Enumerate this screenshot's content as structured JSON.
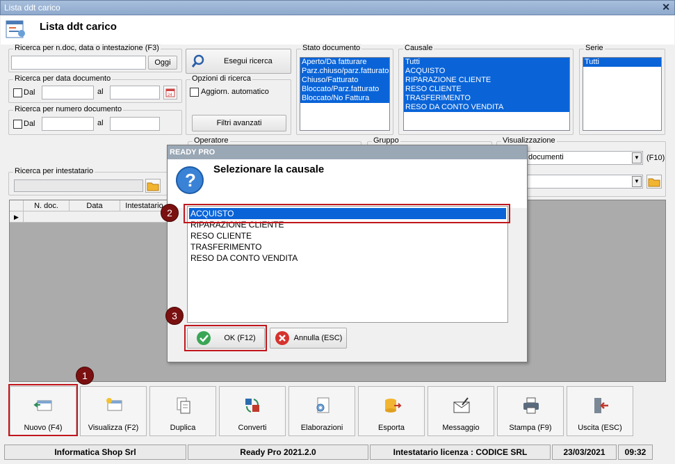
{
  "window": {
    "title": "Lista ddt carico",
    "heading": "Lista ddt carico"
  },
  "search": {
    "by_doc_legend": "Ricerca per n.doc, data o intestazione (F3)",
    "by_doc_value": "",
    "today_button": "Oggi",
    "run_button": "Esegui ricerca",
    "by_date_legend": "Ricerca per data documento",
    "from_label": "Dal",
    "to_label": "al",
    "by_number_legend": "Ricerca per numero documento",
    "options_legend": "Opzioni di ricerca",
    "auto_update_label": "Aggiorn. automatico",
    "advanced_filters_button": "Filtri avanzati",
    "holder_legend": "Ricerca per intestatario",
    "operator_legend": "Operatore",
    "group_legend": "Gruppo",
    "view_legend": "Visualizzazione",
    "view_value": "documenti",
    "view_shortcut": "(F10)"
  },
  "stato": {
    "legend": "Stato documento",
    "items": [
      "Aperto/Da fatturare",
      "Parz.chiuso/parz.fatturato",
      "Chiuso/Fatturato",
      "Bloccato/Parz.fatturato",
      "Bloccato/No Fattura"
    ]
  },
  "causale": {
    "legend": "Causale",
    "items": [
      "Tutti",
      "ACQUISTO",
      "RIPARAZIONE CLIENTE",
      "RESO CLIENTE",
      "TRASFERIMENTO",
      "RESO DA CONTO VENDITA"
    ]
  },
  "serie": {
    "legend": "Serie",
    "items": [
      "Tutti"
    ]
  },
  "grid": {
    "columns": [
      "N. doc.",
      "Data",
      "Intestatario"
    ]
  },
  "toolbar": {
    "buttons": [
      "Nuovo (F4)",
      "Visualizza (F2)",
      "Duplica",
      "Converti",
      "Elaborazioni",
      "Esporta",
      "Messaggio",
      "Stampa (F9)",
      "Uscita (ESC)"
    ]
  },
  "statusbar": {
    "company": "Informatica Shop Srl",
    "version": "Ready Pro 2021.2.0",
    "license": "Intestatario licenza : CODICE SRL",
    "date": "23/03/2021",
    "time": "09:32"
  },
  "dialog": {
    "title": "READY PRO",
    "prompt": "Selezionare la causale",
    "items": [
      "ACQUISTO",
      "RIPARAZIONE CLIENTE",
      "RESO CLIENTE",
      "TRASFERIMENTO",
      "RESO DA CONTO VENDITA"
    ],
    "selected_index": 0,
    "ok_button": "OK (F12)",
    "cancel_button": "Annulla (ESC)"
  },
  "markers": [
    "1",
    "2",
    "3"
  ],
  "colors": {
    "selection": "#0a64d8",
    "marker": "#7a1010",
    "highlight_border": "#c0161c"
  }
}
